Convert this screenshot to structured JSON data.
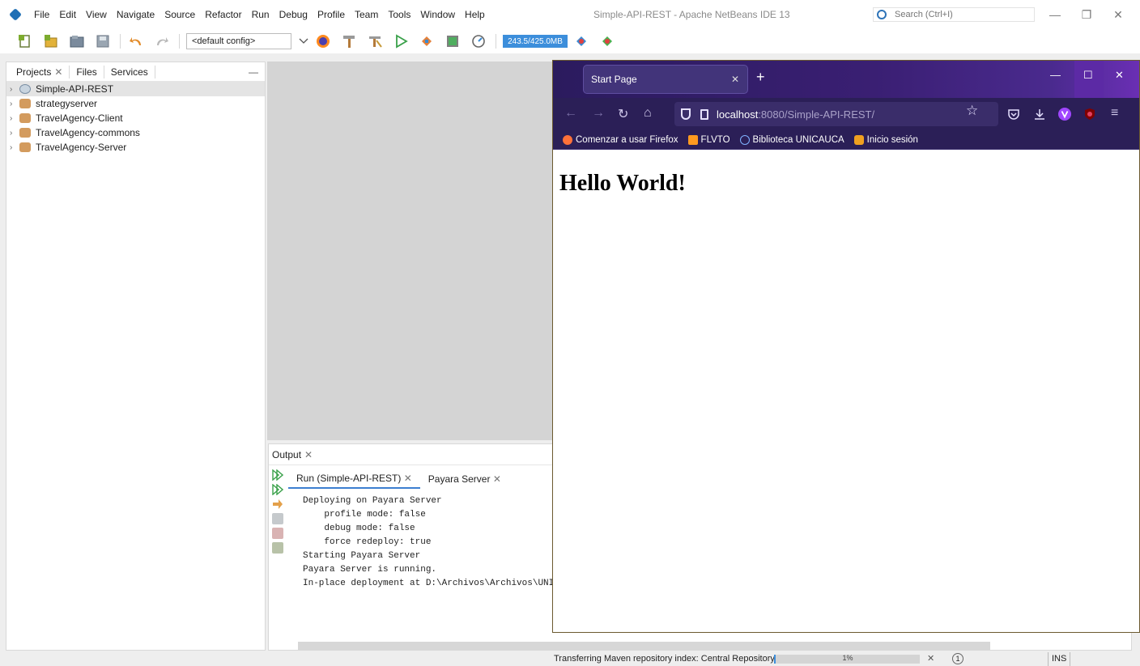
{
  "ide": {
    "title": "Simple-API-REST - Apache NetBeans IDE 13",
    "menu": [
      "File",
      "Edit",
      "View",
      "Navigate",
      "Source",
      "Refactor",
      "Run",
      "Debug",
      "Profile",
      "Team",
      "Tools",
      "Window",
      "Help"
    ],
    "search_placeholder": "Search (Ctrl+I)",
    "window_controls": {
      "minimize": "—",
      "maximize": "❐",
      "close": "✕"
    }
  },
  "toolbar": {
    "config": "<default config>",
    "memory": "243.5/425.0MB"
  },
  "projects_panel": {
    "tabs": [
      "Projects",
      "Files",
      "Services"
    ],
    "items": [
      "Simple-API-REST",
      "strategyserver",
      "TravelAgency-Client",
      "TravelAgency-commons",
      "TravelAgency-Server"
    ]
  },
  "output": {
    "title": "Output",
    "tabs": [
      "Run (Simple-API-REST)",
      "Payara Server"
    ],
    "lines": [
      "Deploying on Payara Server",
      "    profile mode: false",
      "    debug mode: false",
      "    force redeploy: true",
      "Starting Payara Server",
      "Payara Server is running.",
      "In-place deployment at D:\\Archivos\\Archivos\\UNI"
    ]
  },
  "status": {
    "text": "Transferring Maven repository index: Central Repository",
    "progress_label": "1%",
    "progress": 0.01,
    "notifications": "1",
    "mode": "INS"
  },
  "browser": {
    "tab_title": "Start Page",
    "url_host": "localhost",
    "url_path": ":8080/Simple-API-REST/",
    "bookmarks": [
      {
        "label": "Comenzar a usar Firefox",
        "color": "#ff7139"
      },
      {
        "label": "FLVTO",
        "color": "#ff9a1f"
      },
      {
        "label": "Biblioteca UNICAUCA",
        "color": "#7fb2ff"
      },
      {
        "label": "Inicio sesión",
        "color": "#f0a020"
      }
    ],
    "heading": "Hello World!"
  }
}
